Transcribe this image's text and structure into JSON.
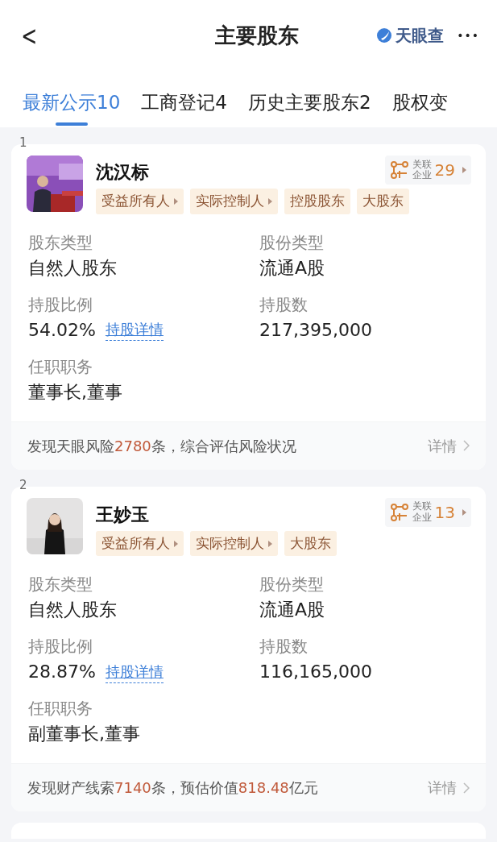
{
  "header": {
    "back": "<",
    "title": "主要股东",
    "brand": "天眼查",
    "more": "•••"
  },
  "tabs": [
    {
      "label": "最新公示10",
      "selected": true
    },
    {
      "label": "工商登记4",
      "selected": false
    },
    {
      "label": "历史主要股东2",
      "selected": false
    },
    {
      "label": "股权变",
      "selected": false
    }
  ],
  "shareholders": [
    {
      "index": "1",
      "name": "沈汉标",
      "photo": {
        "kind": "picture"
      },
      "related": {
        "label_top": "关联",
        "label_bottom": "企业",
        "count": "29"
      },
      "tags": [
        {
          "label": "受益所有人",
          "has_arrow": true
        },
        {
          "label": "实际控制人",
          "has_arrow": true
        },
        {
          "label": "控股股东",
          "has_arrow": false
        },
        {
          "label": "大股东",
          "has_arrow": false
        }
      ],
      "fields": [
        {
          "label": "股东类型",
          "value": "自然人股东"
        },
        {
          "label": "股份类型",
          "value": "流通A股"
        },
        {
          "label": "持股比例",
          "value": "54.02%",
          "link": "持股详情"
        },
        {
          "label": "持股数",
          "value": "217,395,000"
        },
        {
          "label": "任职职务",
          "value": "董事长,董事"
        }
      ],
      "footer": {
        "parts": [
          {
            "text": "发现天眼风险",
            "highlight": false
          },
          {
            "text": "2780",
            "highlight": true
          },
          {
            "text": "条，综合评估风险状况",
            "highlight": false
          }
        ],
        "action": "详情"
      }
    },
    {
      "index": "2",
      "name": "王妙玉",
      "photo": {
        "kind": "picture"
      },
      "related": {
        "label_top": "关联",
        "label_bottom": "企业",
        "count": "13"
      },
      "tags": [
        {
          "label": "受益所有人",
          "has_arrow": true
        },
        {
          "label": "实际控制人",
          "has_arrow": true
        },
        {
          "label": "大股东",
          "has_arrow": false
        }
      ],
      "fields": [
        {
          "label": "股东类型",
          "value": "自然人股东"
        },
        {
          "label": "股份类型",
          "value": "流通A股"
        },
        {
          "label": "持股比例",
          "value": "28.87%",
          "link": "持股详情"
        },
        {
          "label": "持股数",
          "value": "116,165,000"
        },
        {
          "label": "任职职务",
          "value": "副董事长,董事"
        }
      ],
      "footer": {
        "parts": [
          {
            "text": "发现财产线索",
            "highlight": false
          },
          {
            "text": "7140",
            "highlight": true
          },
          {
            "text": "条，预估价值",
            "highlight": false
          },
          {
            "text": "818.48",
            "highlight": true
          },
          {
            "text": "亿元",
            "highlight": false
          }
        ],
        "action": "详情"
      }
    }
  ]
}
